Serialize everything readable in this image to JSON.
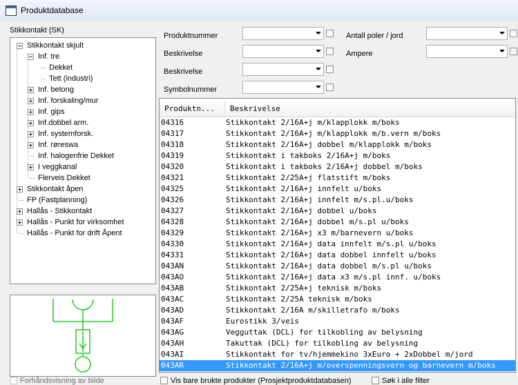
{
  "window": {
    "title": "Produktdatabase"
  },
  "tree": {
    "label": "Stikkontakt (SK)",
    "nodes": [
      {
        "text": "Stikkontakt skjult",
        "level": 0,
        "box": "minus"
      },
      {
        "text": "Inf. tre",
        "level": 1,
        "box": "minus"
      },
      {
        "text": "Dekket",
        "level": 2,
        "box": "none",
        "selected": false
      },
      {
        "text": "Tett (industri)",
        "level": 2,
        "box": "none"
      },
      {
        "text": "Inf. betong",
        "level": 1,
        "box": "plus"
      },
      {
        "text": "Inf. forskaling/mur",
        "level": 1,
        "box": "plus"
      },
      {
        "text": "Inf. gips",
        "level": 1,
        "box": "plus"
      },
      {
        "text": "Inf.dobbel arm.",
        "level": 1,
        "box": "plus"
      },
      {
        "text": "Inf. systemforsk.",
        "level": 1,
        "box": "plus"
      },
      {
        "text": "Inf. røreswa",
        "level": 1,
        "box": "plus"
      },
      {
        "text": "Inf. halogenfrie Dekket",
        "level": 1,
        "box": "none"
      },
      {
        "text": "I veggkanal",
        "level": 1,
        "box": "plus"
      },
      {
        "text": "Flerveis Dekket",
        "level": 1,
        "box": "none"
      },
      {
        "text": "Stikkontakt åpen",
        "level": 0,
        "box": "plus"
      },
      {
        "text": "FP (Fastplanning)",
        "level": 0,
        "box": "none"
      },
      {
        "text": "Hallås - Stikkontakt",
        "level": 0,
        "box": "plus"
      },
      {
        "text": "Hallås - Punkt for virksomhet",
        "level": 0,
        "box": "plus"
      },
      {
        "text": "Hallås - Punkt for drift Åpent",
        "level": 0,
        "box": "none"
      }
    ]
  },
  "preview": {
    "checkbox_label": "Forhåndsvisning av bilde"
  },
  "filters": {
    "left": [
      {
        "label": "Produktnummer",
        "value": ""
      },
      {
        "label": "Beskrivelse",
        "value": ""
      },
      {
        "label": "Beskrivelse",
        "value": ""
      },
      {
        "label": "Symbolnummer",
        "value": ""
      }
    ],
    "right": [
      {
        "label": "Antall poler / jord",
        "value": ""
      },
      {
        "label": "Ampere",
        "value": ""
      }
    ]
  },
  "list": {
    "columns": [
      "Produktn...",
      "Beskrivelse"
    ],
    "rows": [
      [
        "04316",
        "Stikkontakt 2/16A+j m/klapplokk m/boks"
      ],
      [
        "04317",
        "Stikkontakt 2/16A+j m/klapplokk m/b.vern m/boks"
      ],
      [
        "04318",
        "Stikkontakt 2/16A+j dobbel m/klapplokk m/boks"
      ],
      [
        "04319",
        "Stikkontakt i takboks 2/16A+j m/boks"
      ],
      [
        "04320",
        "Stikkontakt i takboks 2/16A+j dobbel m/boks"
      ],
      [
        "04321",
        "Stikkontakt 2/25A+j flatstift m/boks"
      ],
      [
        "04325",
        "Stikkontakt 2/16A+j innfelt u/boks"
      ],
      [
        "04326",
        "Stikkontakt 2/16A+j innfelt m/s.pl.u/boks"
      ],
      [
        "04327",
        "Stikkontakt 2/16A+j dobbel u/boks"
      ],
      [
        "04328",
        "Stikkontakt 2/16A+j dobbel m/s.pl u/boks"
      ],
      [
        "04329",
        "Stikkontakt 2/16A+j x3 m/barnevern u/boks"
      ],
      [
        "04330",
        "Stikkontakt 2/16A+j data innfelt m/s.pl u/boks"
      ],
      [
        "04331",
        "Stikkontakt 2/16A+j data dobbel innfelt u/boks"
      ],
      [
        "043AN",
        "Stikkontakt 2/16A+j data dobbel m/s.pl u/boks"
      ],
      [
        "043AO",
        "Stikkontakt 2/16A+j data x3 m/s.pl innf. u/boks"
      ],
      [
        "043AB",
        "Stikkontakt 2/25A+j teknisk m/boks"
      ],
      [
        "043AC",
        "Stikkontakt 2/25A   teknisk m/boks"
      ],
      [
        "043AD",
        "Stikkontakt 2/16A   m/skilletrafo m/boks"
      ],
      [
        "043AF",
        "Eurostikk 3/veis"
      ],
      [
        "043AG",
        "Vegguttak (DCL) for tilkobling av belysning"
      ],
      [
        "043AH",
        "Takuttak (DCL) for tilkobling av belysning"
      ],
      [
        "043AI",
        "Stikkontakt for tv/hjemmekino 3xEuro + 2xDobbel m/jord"
      ],
      [
        "043AR",
        "Stikkontakt 2/16A+j m/overspenningsvern og barnevern m/boks"
      ]
    ],
    "selected_index": 22
  },
  "bottom": {
    "only_used_label": "Vis bare brukte produkter (Prosjektproduktdatabasen)",
    "search_all_label": "Søk i alle filter"
  },
  "colors": {
    "selection": "#3399ff",
    "symbol_green": "#00c000"
  }
}
